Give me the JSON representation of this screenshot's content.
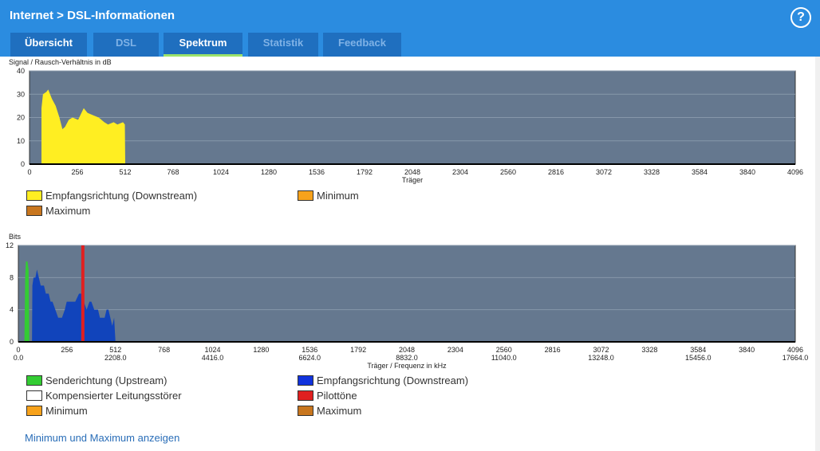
{
  "header": {
    "title": "Internet > DSL-Informationen",
    "help": "?"
  },
  "tabs": [
    {
      "label": "Übersicht"
    },
    {
      "label": "DSL"
    },
    {
      "label": "Spektrum"
    },
    {
      "label": "Statistik"
    },
    {
      "label": "Feedback"
    }
  ],
  "chart_data": [
    {
      "type": "area",
      "title": "Signal / Rausch-Verhältnis in dB",
      "xlabel": "Träger",
      "ylabel": "Signal / Rausch-Verhältnis in dB",
      "xlim": [
        0,
        4096
      ],
      "ylim": [
        0,
        40
      ],
      "xticks": [
        "0",
        "256",
        "512",
        "768",
        "1024",
        "1280",
        "1536",
        "1792",
        "2048",
        "2304",
        "2560",
        "2816",
        "3072",
        "3328",
        "3584",
        "3840",
        "4096"
      ],
      "yticks": [
        "0",
        "10",
        "20",
        "30",
        "40"
      ],
      "series": [
        {
          "name": "Empfangsrichtung (Downstream)",
          "color": "#ffee22",
          "points": [
            [
              64,
              0
            ],
            [
              64,
              24
            ],
            [
              72,
              30
            ],
            [
              90,
              31
            ],
            [
              100,
              32
            ],
            [
              120,
              28
            ],
            [
              140,
              25
            ],
            [
              160,
              20
            ],
            [
              176,
              15
            ],
            [
              190,
              16
            ],
            [
              210,
              19
            ],
            [
              230,
              20
            ],
            [
              260,
              19
            ],
            [
              290,
              24
            ],
            [
              310,
              22
            ],
            [
              340,
              21
            ],
            [
              370,
              20
            ],
            [
              400,
              18
            ],
            [
              420,
              17
            ],
            [
              450,
              18
            ],
            [
              470,
              17
            ],
            [
              500,
              18
            ],
            [
              510,
              17
            ],
            [
              512,
              0
            ]
          ]
        }
      ],
      "legend": [
        {
          "label": "Empfangsrichtung (Downstream)",
          "color": "#ffee22"
        },
        {
          "label": "Minimum",
          "color": "#f7a21b"
        },
        {
          "label": "Maximum",
          "color": "#c8761e"
        }
      ]
    },
    {
      "type": "area",
      "title": "Bits",
      "xlabel": "Träger / Frequenz in kHz",
      "ylabel": "Bits",
      "xlim": [
        0,
        4096
      ],
      "ylim": [
        0,
        12
      ],
      "xticks": [
        "0",
        "256",
        "512",
        "768",
        "1024",
        "1280",
        "1536",
        "1792",
        "2048",
        "2304",
        "2560",
        "2816",
        "3072",
        "3328",
        "3584",
        "3840",
        "4096"
      ],
      "xticks2": [
        "0.0",
        "",
        "2208.0",
        "",
        "4416.0",
        "",
        "6624.0",
        "",
        "8832.0",
        "",
        "11040.0",
        "",
        "13248.0",
        "",
        "15456.0",
        "",
        "17664.0"
      ],
      "yticks": [
        "0",
        "4",
        "8",
        "12"
      ],
      "series": [
        {
          "name": "Sendericht­ung (Upstream)",
          "color": "#33cc33",
          "points": [
            [
              32,
              0
            ],
            [
              36,
              8
            ],
            [
              40,
              10
            ],
            [
              48,
              10
            ],
            [
              54,
              9
            ],
            [
              58,
              0
            ]
          ]
        },
        {
          "name": "Empfangsrichtung (Downstream)",
          "color": "#1144bb",
          "points": [
            [
              72,
              0
            ],
            [
              74,
              7
            ],
            [
              80,
              8
            ],
            [
              90,
              8
            ],
            [
              98,
              9
            ],
            [
              108,
              8
            ],
            [
              118,
              7
            ],
            [
              135,
              7
            ],
            [
              145,
              6
            ],
            [
              160,
              6
            ],
            [
              170,
              5
            ],
            [
              180,
              5
            ],
            [
              195,
              4
            ],
            [
              210,
              3
            ],
            [
              230,
              3
            ],
            [
              245,
              4
            ],
            [
              255,
              5
            ],
            [
              300,
              5
            ],
            [
              320,
              6
            ],
            [
              335,
              6
            ],
            [
              345,
              5
            ],
            [
              360,
              4
            ],
            [
              375,
              5
            ],
            [
              385,
              5
            ],
            [
              400,
              4
            ],
            [
              420,
              4
            ],
            [
              430,
              3
            ],
            [
              455,
              3
            ],
            [
              465,
              4
            ],
            [
              475,
              4
            ],
            [
              485,
              3
            ],
            [
              495,
              2
            ],
            [
              505,
              3
            ],
            [
              512,
              0
            ]
          ]
        },
        {
          "name": "Pilottöne",
          "color": "#e02020",
          "pilot": 340
        }
      ],
      "legend": [
        {
          "label": "Senderichtung (Upstream)",
          "color": "#33cc33"
        },
        {
          "label": "Empfangsrichtung (Downstream)",
          "color": "#1133dd"
        },
        {
          "label": "Kompensierter Leitungsstörer",
          "color": "#ffffff"
        },
        {
          "label": "Pilottöne",
          "color": "#e02020"
        },
        {
          "label": "Minimum",
          "color": "#f7a21b"
        },
        {
          "label": "Maximum",
          "color": "#c8761e"
        }
      ]
    }
  ],
  "link": "Minimum und Maximum anzeigen"
}
